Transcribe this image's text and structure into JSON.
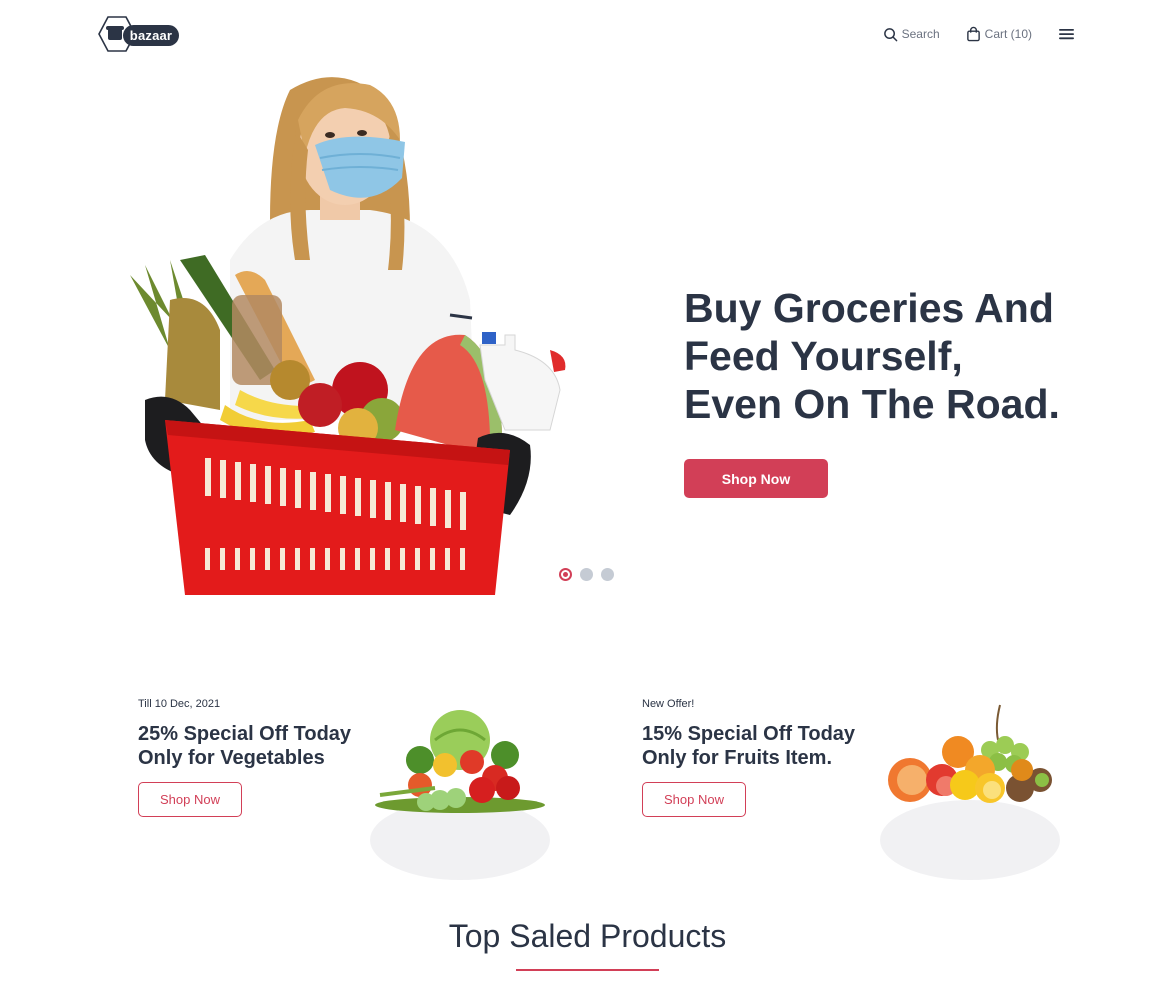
{
  "brand": {
    "name": "bazaar",
    "accent_color": "#d23f57",
    "text_color": "#2b3445"
  },
  "header": {
    "search_label": "Search",
    "cart_label": "Cart (10)",
    "icons": {
      "search": "search-icon",
      "cart": "shopping-bag-icon",
      "menu": "hamburger-menu-icon"
    }
  },
  "hero": {
    "title": "Buy Groceries And\nFeed Yourself,\nEven On The Road.",
    "button_label": "Shop Now",
    "slides_count": 3,
    "active_slide": 1
  },
  "offers": [
    {
      "tag": "Till 10 Dec, 2021",
      "title": "25% Special Off Today\nOnly for Vegetables",
      "button_label": "Shop Now"
    },
    {
      "tag": "New Offer!",
      "title": "15% Special Off Today\nOnly for Fruits Item.",
      "button_label": "Shop Now"
    }
  ],
  "section": {
    "title": "Top Saled Products"
  }
}
